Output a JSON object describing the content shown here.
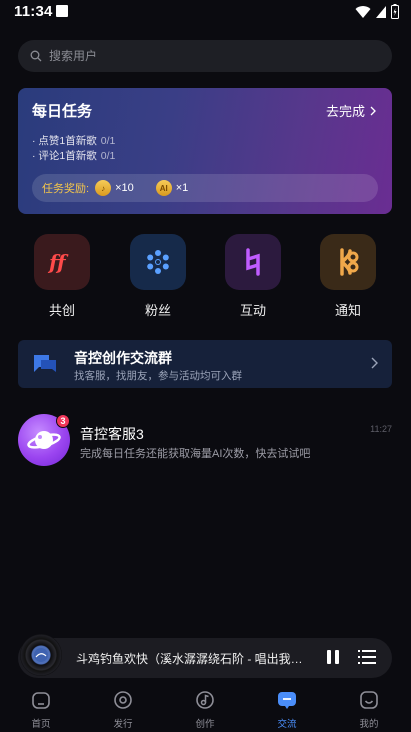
{
  "status_bar": {
    "time": "11:34"
  },
  "search": {
    "placeholder": "搜索用户"
  },
  "daily_task": {
    "title": "每日任务",
    "action": "去完成",
    "tasks": [
      {
        "text": "· 点赞1首新歌",
        "progress": "0/1"
      },
      {
        "text": "· 评论1首新歌",
        "progress": "0/1"
      }
    ],
    "reward_label": "任务奖励:",
    "rewards": [
      {
        "icon": "note-coin-icon",
        "amount": "×10",
        "glyph": "♪"
      },
      {
        "icon": "ai-coin-icon",
        "amount": "×1",
        "glyph": "AI"
      }
    ]
  },
  "features": [
    {
      "label": "共创",
      "icon": "ff-icon",
      "color": "#ff4a4a",
      "bg": "#3a1a1d"
    },
    {
      "label": "粉丝",
      "icon": "snowflake-icon",
      "color": "#5aa0ff",
      "bg": "#162a4a"
    },
    {
      "label": "互动",
      "icon": "natural-sign-icon",
      "color": "#c05cff",
      "bg": "#2c1a3e"
    },
    {
      "label": "通知",
      "icon": "rune-icon",
      "color": "#f0a84a",
      "bg": "#3a2a18"
    }
  ],
  "group": {
    "title": "音控创作交流群",
    "subtitle": "找客服，找朋友，参与活动均可入群"
  },
  "chats": [
    {
      "name": "音控客服3",
      "message": "完成每日任务还能获取海量AI次数，快去试试吧",
      "time": "11:27",
      "badge": "3"
    }
  ],
  "player": {
    "song": "斗鸡钓鱼欢快（溪水潺潺绕石阶 - 唱出我世界范儿"
  },
  "tabs": [
    {
      "label": "首页",
      "icon": "home-icon"
    },
    {
      "label": "发行",
      "icon": "disc-icon"
    },
    {
      "label": "创作",
      "icon": "music-create-icon"
    },
    {
      "label": "交流",
      "icon": "chat-icon",
      "active": true
    },
    {
      "label": "我的",
      "icon": "profile-icon"
    }
  ],
  "colors": {
    "accent": "#4a8df8",
    "background": "#0b0b10",
    "badge": "#f0365a"
  }
}
